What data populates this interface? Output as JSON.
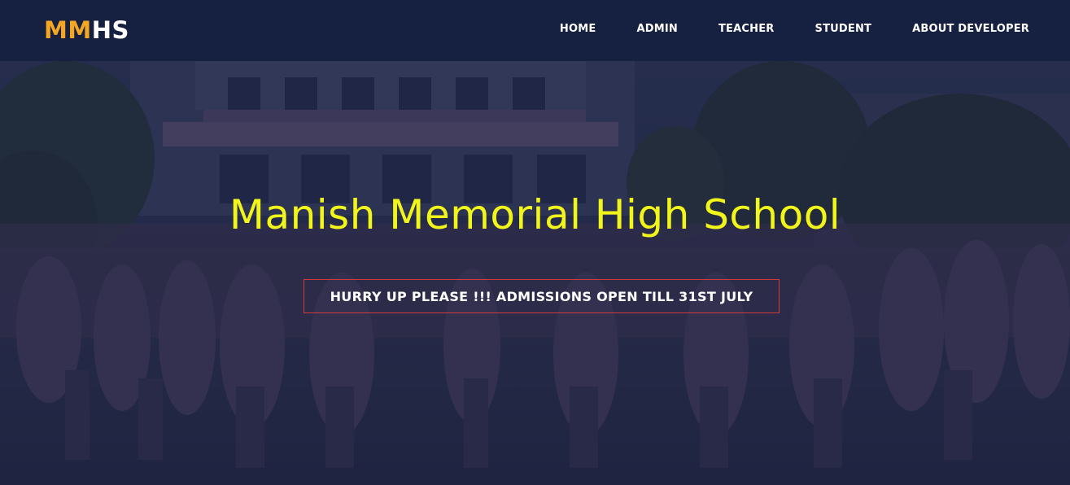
{
  "logo": {
    "part1": "MM",
    "part2": "HS"
  },
  "nav": {
    "items": [
      {
        "label": "HOME"
      },
      {
        "label": "ADMIN"
      },
      {
        "label": "TEACHER"
      },
      {
        "label": "STUDENT"
      },
      {
        "label": "ABOUT DEVELOPER"
      }
    ]
  },
  "hero": {
    "title": "Manish Memorial High School",
    "banner": "HURRY UP PLEASE !!! ADMISSIONS OPEN TILL 31ST JULY"
  },
  "colors": {
    "navbar_bg": "#162040",
    "logo_accent": "#f5a623",
    "title_color": "#f2f51a",
    "banner_border": "#d23a3a"
  }
}
